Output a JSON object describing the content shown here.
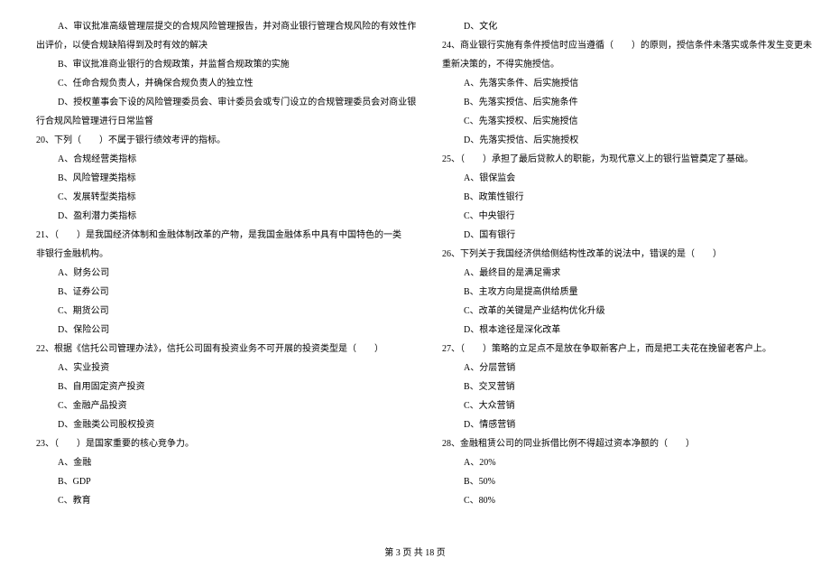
{
  "left": {
    "q19_intro_a": "A、审议批准高级管理层提交的合规风险管理报告，并对商业银行管理合规风险的有效性作",
    "q19_intro_b": "出评价，以使合规缺陷得到及时有效的解决",
    "q19_opt_b": "B、审议批准商业银行的合规政策，并监督合规政策的实施",
    "q19_opt_c": "C、任命合规负责人，并确保合规负责人的独立性",
    "q19_opt_d1": "D、授权董事会下设的风险管理委员会、审计委员会或专门设立的合规管理委员会对商业银",
    "q19_opt_d2": "行合规风险管理进行日常监督",
    "q20_stem": "20、下列（　　）不属于银行绩效考评的指标。",
    "q20_a": "A、合规经营类指标",
    "q20_b": "B、风险管理类指标",
    "q20_c": "C、发展转型类指标",
    "q20_d": "D、盈利潜力类指标",
    "q21_stem1": "21、（　　）是我国经济体制和金融体制改革的产物，是我国金融体系中具有中国特色的一类",
    "q21_stem2": "非银行金融机构。",
    "q21_a": "A、财务公司",
    "q21_b": "B、证券公司",
    "q21_c": "C、期货公司",
    "q21_d": "D、保险公司",
    "q22_stem": "22、根据《信托公司管理办法》，信托公司固有投资业务不可开展的投资类型是（　　）",
    "q22_a": "A、实业投资",
    "q22_b": "B、自用固定资产投资",
    "q22_c": "C、金融产品投资",
    "q22_d": "D、金融类公司股权投资",
    "q23_stem": "23、（　　）是国家重要的核心竞争力。",
    "q23_a": "A、金融",
    "q23_b": "B、GDP",
    "q23_c": "C、教育"
  },
  "right": {
    "q23_d": "D、文化",
    "q24_stem1": "24、商业银行实施有条件授信时应当遵循（　　）的原则，授信条件未落实或条件发生变更未",
    "q24_stem2": "重新决策的，不得实施授信。",
    "q24_a": "A、先落实条件、后实施授信",
    "q24_b": "B、先落实授信、后实施条件",
    "q24_c": "C、先落实授权、后实施授信",
    "q24_d": "D、先落实授信、后实施授权",
    "q25_stem": "25、（　　）承担了最后贷款人的职能，为现代意义上的银行监管奠定了基础。",
    "q25_a": "A、银保监会",
    "q25_b": "B、政策性银行",
    "q25_c": "C、中央银行",
    "q25_d": "D、国有银行",
    "q26_stem": "26、下列关于我国经济供给侧结构性改革的说法中，错误的是（　　）",
    "q26_a": "A、最终目的是满足需求",
    "q26_b": "B、主攻方向是提高供给质量",
    "q26_c": "C、改革的关键是产业结构优化升级",
    "q26_d": "D、根本途径是深化改革",
    "q27_stem": "27、（　　）策略的立足点不是放在争取新客户上，而是把工夫花在挽留老客户上。",
    "q27_a": "A、分层营销",
    "q27_b": "B、交叉营销",
    "q27_c": "C、大众营销",
    "q27_d": "D、情感营销",
    "q28_stem": "28、金融租赁公司的同业拆借比例不得超过资本净额的（　　）",
    "q28_a": "A、20%",
    "q28_b": "B、50%",
    "q28_c": "C、80%"
  },
  "footer": "第 3 页 共 18 页"
}
